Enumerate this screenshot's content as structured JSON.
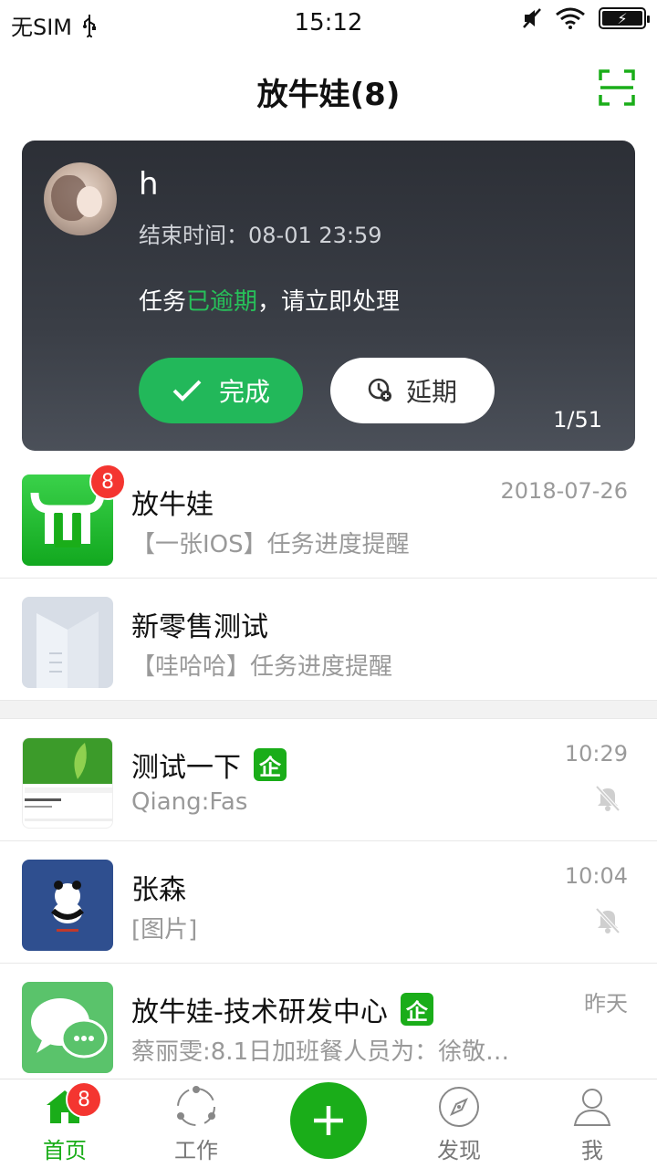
{
  "status_bar": {
    "carrier": "无SIM",
    "time": "15:12"
  },
  "header": {
    "title": "放牛娃(8)"
  },
  "task_card": {
    "name": "h",
    "end_time": "结束时间：08-01 23:59",
    "msg_prefix": "任务",
    "msg_highlight": "已逾期",
    "msg_suffix": "，请立即处理",
    "done_label": "完成",
    "delay_label": "延期",
    "page": "1/51",
    "highlight_color": "#27c15a"
  },
  "conversations": [
    {
      "title": "放牛娃",
      "subtitle": "【一张IOS】任务进度提醒",
      "time": "2018-07-26",
      "badge": "8"
    },
    {
      "title": "新零售测试",
      "subtitle": "【哇哈哈】任务进度提醒",
      "time": ""
    },
    {
      "title": "测试一下",
      "subtitle": "Qiang:Fas",
      "time": "10:29",
      "ent": "企",
      "muted": true
    },
    {
      "title": "张森",
      "subtitle": "[图片]",
      "time": "10:04",
      "muted": true
    },
    {
      "title": "放牛娃-技术研发中心",
      "subtitle": "蔡丽雯:8.1日加班餐人员为：徐敬…",
      "time": "昨天",
      "ent": "企"
    }
  ],
  "tabbar": {
    "home": "首页",
    "home_badge": "8",
    "work": "工作",
    "discover": "发现",
    "me": "我"
  },
  "colors": {
    "brand_green": "#1aad19",
    "badge_red": "#f43530"
  }
}
